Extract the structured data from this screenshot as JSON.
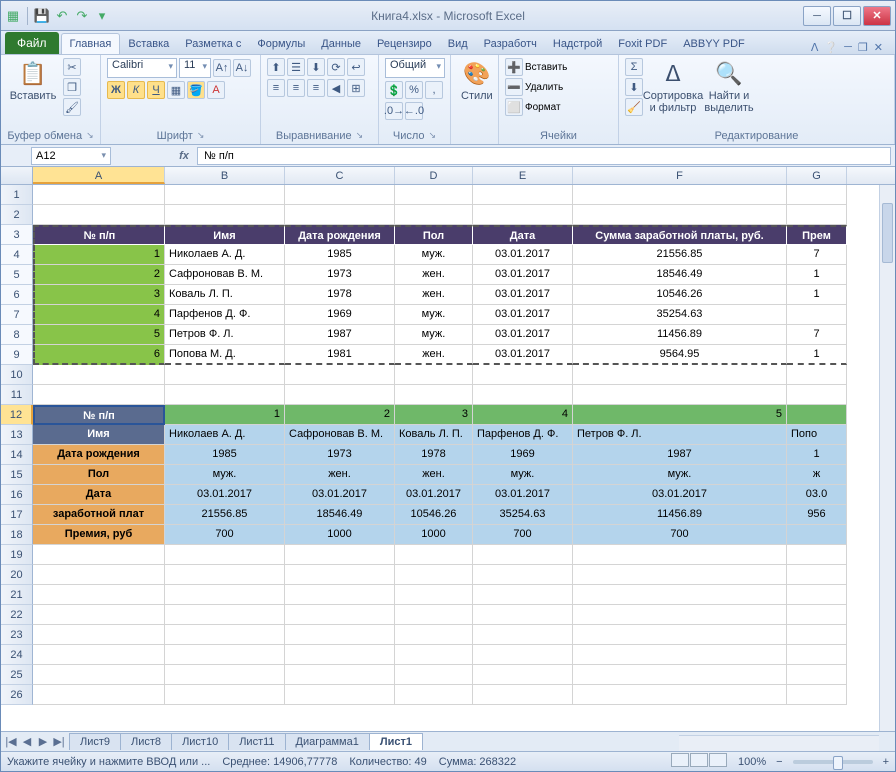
{
  "title": "Книга4.xlsx  -  Microsoft Excel",
  "qat": {
    "save": "💾",
    "undo": "↶",
    "redo": "↷"
  },
  "tabs": {
    "file": "Файл",
    "home": "Главная",
    "insert": "Вставка",
    "layout": "Разметка с",
    "formulas": "Формулы",
    "data": "Данные",
    "review": "Рецензиро",
    "view": "Вид",
    "dev": "Разработч",
    "addins": "Надстрой",
    "foxit": "Foxit PDF",
    "abbyy": "ABBYY PDF"
  },
  "ribbon": {
    "paste": "Вставить",
    "clipboard": "Буфер обмена",
    "font_name": "Calibri",
    "font_size": "11",
    "font": "Шрифт",
    "align": "Выравнивание",
    "numfmt": "Общий",
    "number": "Число",
    "styles": "Стили",
    "insertc": "Вставить",
    "deletec": "Удалить",
    "formatc": "Формат",
    "cells": "Ячейки",
    "sort": "Сортировка и фильтр",
    "find": "Найти и выделить",
    "editing": "Редактирование"
  },
  "namebox": "A12",
  "formula": "№ п/п",
  "cols": {
    "A": 132,
    "B": 120,
    "C": 110,
    "D": 78,
    "E": 100,
    "F": 214,
    "G": 60
  },
  "table1": {
    "headers": [
      "№ п/п",
      "Имя",
      "Дата рождения",
      "Пол",
      "Дата",
      "Сумма заработной платы, руб.",
      "Прем"
    ],
    "rows": [
      [
        "1",
        "Николаев А. Д.",
        "1985",
        "муж.",
        "03.01.2017",
        "21556.85",
        "7"
      ],
      [
        "2",
        "Сафроновав В. М.",
        "1973",
        "жен.",
        "03.01.2017",
        "18546.49",
        "1"
      ],
      [
        "3",
        "Коваль Л. П.",
        "1978",
        "жен.",
        "03.01.2017",
        "10546.26",
        "1"
      ],
      [
        "4",
        "Парфенов Д. Ф.",
        "1969",
        "муж.",
        "03.01.2017",
        "35254.63",
        ""
      ],
      [
        "5",
        "Петров Ф. Л.",
        "1987",
        "муж.",
        "03.01.2017",
        "11456.89",
        "7"
      ],
      [
        "6",
        "Попова М. Д.",
        "1981",
        "жен.",
        "03.01.2017",
        "9564.95",
        "1"
      ]
    ]
  },
  "table2": {
    "labels": [
      "№ п/п",
      "Имя",
      "Дата рождения",
      "Пол",
      "Дата",
      "заработной плат",
      "Премия, руб"
    ],
    "cols": [
      [
        "1",
        "Николаев А. Д.",
        "1985",
        "муж.",
        "03.01.2017",
        "21556.85",
        "700"
      ],
      [
        "2",
        "Сафроновав В. М.",
        "1973",
        "жен.",
        "03.01.2017",
        "18546.49",
        "1000"
      ],
      [
        "3",
        "Коваль Л. П.",
        "1978",
        "жен.",
        "03.01.2017",
        "10546.26",
        "1000"
      ],
      [
        "4",
        "Парфенов Д. Ф.",
        "1969",
        "муж.",
        "03.01.2017",
        "35254.63",
        "700"
      ],
      [
        "5",
        "Петров Ф. Л.",
        "1987",
        "муж.",
        "03.01.2017",
        "11456.89",
        "700"
      ],
      [
        "",
        "Попо",
        "1",
        "ж",
        "03.0",
        "956",
        ""
      ]
    ]
  },
  "sheets": [
    "Лист9",
    "Лист8",
    "Лист10",
    "Лист11",
    "Диаграмма1",
    "Лист1"
  ],
  "active_sheet": "Лист1",
  "status": {
    "hint": "Укажите ячейку и нажмите ВВОД или ...",
    "avg": "Среднее: 14906,77778",
    "count": "Количество: 49",
    "sum": "Сумма: 268322",
    "zoom": "100%"
  }
}
